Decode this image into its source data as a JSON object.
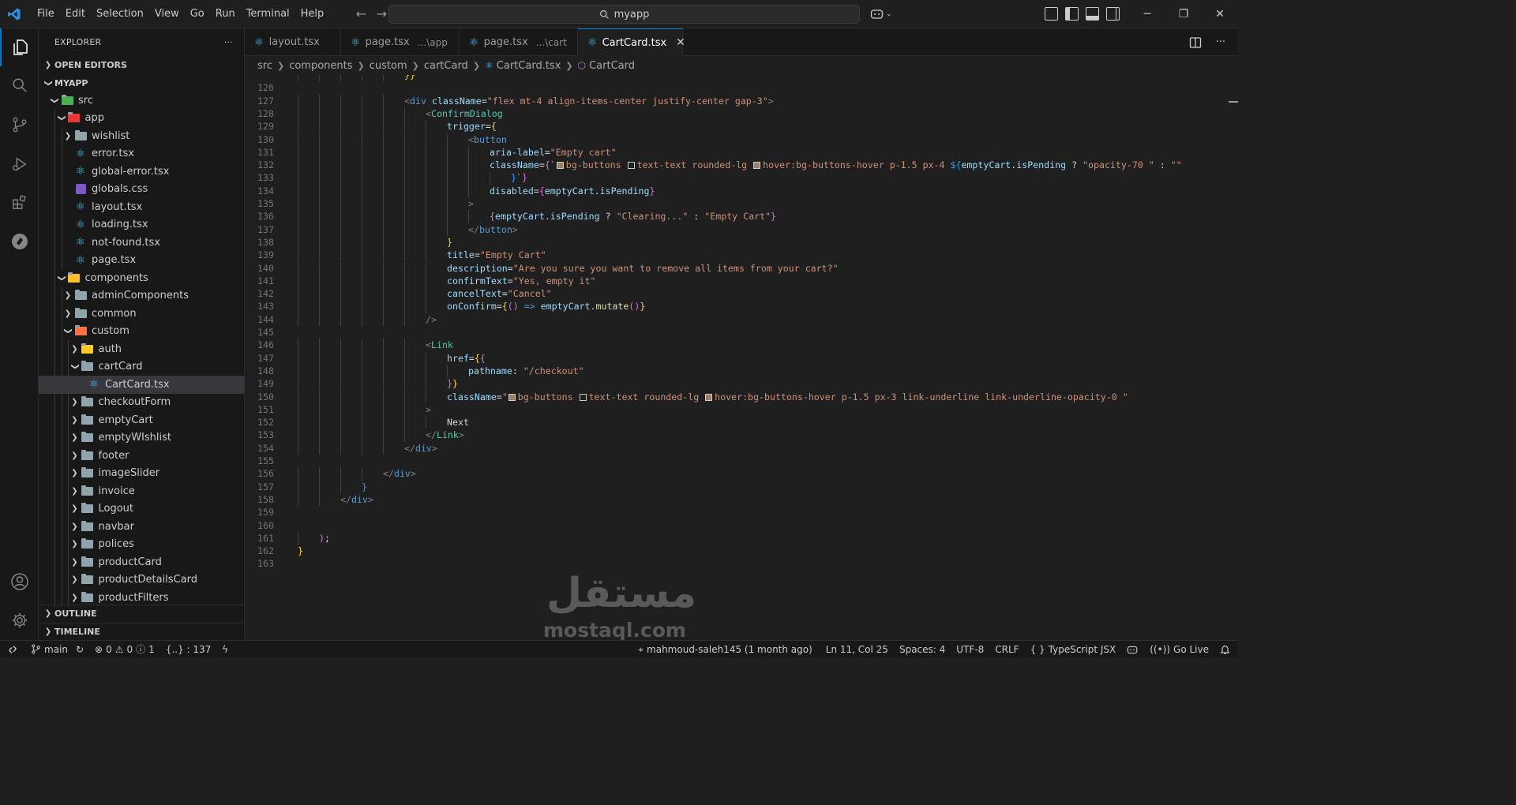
{
  "titlebar": {
    "menu": [
      "File",
      "Edit",
      "Selection",
      "View",
      "Go",
      "Run",
      "Terminal",
      "Help"
    ],
    "search_text": "myapp",
    "icons": [
      "vscode-logo",
      "back-arrow",
      "forward-arrow",
      "copilot-icon",
      "layout-icons",
      "minimize",
      "restore",
      "close"
    ]
  },
  "activitybar": [
    "explorer-icon",
    "search-icon",
    "source-control-icon",
    "run-debug-icon",
    "extensions-icon",
    "remote-explorer-icon",
    "account-icon",
    "settings-gear-icon"
  ],
  "sidebar": {
    "title": "EXPLORER",
    "more": "···",
    "open_editors": "OPEN EDITORS",
    "root": "MYAPP",
    "tree": [
      {
        "label": "src",
        "type": "folder-open",
        "depth": 1
      },
      {
        "label": "app",
        "type": "folder-open",
        "depth": 2
      },
      {
        "label": "wishlist",
        "type": "folder",
        "depth": 3
      },
      {
        "label": "error.tsx",
        "type": "react",
        "depth": 3
      },
      {
        "label": "global-error.tsx",
        "type": "react",
        "depth": 3
      },
      {
        "label": "globals.css",
        "type": "css",
        "depth": 3
      },
      {
        "label": "layout.tsx",
        "type": "react",
        "depth": 3
      },
      {
        "label": "loading.tsx",
        "type": "react",
        "depth": 3
      },
      {
        "label": "not-found.tsx",
        "type": "react",
        "depth": 3
      },
      {
        "label": "page.tsx",
        "type": "react",
        "depth": 3
      },
      {
        "label": "components",
        "type": "folder-open",
        "depth": 2
      },
      {
        "label": "adminComponents",
        "type": "folder",
        "depth": 3
      },
      {
        "label": "common",
        "type": "folder",
        "depth": 3
      },
      {
        "label": "custom",
        "type": "folder-open",
        "depth": 3
      },
      {
        "label": "auth",
        "type": "folder",
        "depth": 4
      },
      {
        "label": "cartCard",
        "type": "folder-open",
        "depth": 4
      },
      {
        "label": "CartCard.tsx",
        "type": "react",
        "depth": 5,
        "selected": true
      },
      {
        "label": "checkoutForm",
        "type": "folder",
        "depth": 4
      },
      {
        "label": "emptyCart",
        "type": "folder",
        "depth": 4
      },
      {
        "label": "emptyWIshlist",
        "type": "folder",
        "depth": 4
      },
      {
        "label": "footer",
        "type": "folder",
        "depth": 4
      },
      {
        "label": "imageSlider",
        "type": "folder",
        "depth": 4
      },
      {
        "label": "invoice",
        "type": "folder",
        "depth": 4
      },
      {
        "label": "Logout",
        "type": "folder",
        "depth": 4
      },
      {
        "label": "navbar",
        "type": "folder",
        "depth": 4
      },
      {
        "label": "polices",
        "type": "folder",
        "depth": 4
      },
      {
        "label": "productCard",
        "type": "folder",
        "depth": 4
      },
      {
        "label": "productDetailsCard",
        "type": "folder",
        "depth": 4
      },
      {
        "label": "productFilters",
        "type": "folder",
        "depth": 4
      }
    ],
    "outline": "OUTLINE",
    "timeline": "TIMELINE"
  },
  "tabs": [
    {
      "label": "layout.tsx",
      "desc": ""
    },
    {
      "label": "page.tsx",
      "desc": "...\\app"
    },
    {
      "label": "page.tsx",
      "desc": "...\\cart"
    },
    {
      "label": "CartCard.tsx",
      "desc": "",
      "active": true
    }
  ],
  "breadcrumb": [
    "src",
    "components",
    "custom",
    "cartCard",
    "CartCard.tsx",
    "CartCard"
  ],
  "editor": {
    "lines": [
      {
        "n": "",
        "indent": 5,
        "tokens": [
          [
            "t-br1",
            "}}"
          ]
        ]
      },
      {
        "n": "126",
        "indent": 0,
        "tokens": []
      },
      {
        "n": "127",
        "indent": 5,
        "tokens": [
          [
            "t-punc",
            "<"
          ],
          [
            "t-tag",
            "div"
          ],
          [
            "t-txt",
            " "
          ],
          [
            "t-attr",
            "className"
          ],
          [
            "t-txt",
            "="
          ],
          [
            "t-str",
            "\"flex mt-4 align-items-center justify-center gap-3\""
          ],
          [
            "t-punc",
            ">"
          ]
        ]
      },
      {
        "n": "128",
        "indent": 6,
        "tokens": [
          [
            "t-punc",
            "<"
          ],
          [
            "t-comp",
            "ConfirmDialog"
          ]
        ]
      },
      {
        "n": "129",
        "indent": 7,
        "tokens": [
          [
            "t-attr",
            "trigger"
          ],
          [
            "t-txt",
            "="
          ],
          [
            "t-br1",
            "{"
          ]
        ]
      },
      {
        "n": "130",
        "indent": 8,
        "tokens": [
          [
            "t-punc",
            "<"
          ],
          [
            "t-tag",
            "button"
          ]
        ]
      },
      {
        "n": "131",
        "indent": 9,
        "tokens": [
          [
            "t-attr",
            "aria-label"
          ],
          [
            "t-txt",
            "="
          ],
          [
            "t-str",
            "\"Empty cart\""
          ]
        ]
      },
      {
        "n": "132",
        "indent": 9,
        "tokens": [
          [
            "t-attr",
            "className"
          ],
          [
            "t-txt",
            "="
          ],
          [
            "t-br2",
            "{"
          ],
          [
            "t-str",
            "`"
          ],
          [
            "sw",
            "#9c8163"
          ],
          [
            "t-str",
            "bg-buttons "
          ],
          [
            "sw",
            "#1f1f1f"
          ],
          [
            "t-str",
            "text-text rounded-lg "
          ],
          [
            "sw",
            "#9c8163"
          ],
          [
            "t-str",
            "hover:bg-buttons-hover p-1.5 px-4 "
          ],
          [
            "t-br3",
            "${"
          ],
          [
            "t-var",
            "emptyCart"
          ],
          [
            "t-txt",
            "."
          ],
          [
            "t-var",
            "isPending"
          ],
          [
            "t-txt",
            " ? "
          ],
          [
            "t-str",
            "\"opacity-70 \""
          ],
          [
            "t-txt",
            " : "
          ],
          [
            "t-str",
            "\"\""
          ]
        ]
      },
      {
        "n": "133",
        "indent": 10,
        "tokens": [
          [
            "t-br3",
            "}"
          ],
          [
            "t-str",
            "`"
          ],
          [
            "t-br2",
            "}"
          ]
        ]
      },
      {
        "n": "134",
        "indent": 9,
        "tokens": [
          [
            "t-attr",
            "disabled"
          ],
          [
            "t-txt",
            "="
          ],
          [
            "t-br2",
            "{"
          ],
          [
            "t-var",
            "emptyCart"
          ],
          [
            "t-txt",
            "."
          ],
          [
            "t-var",
            "isPending"
          ],
          [
            "t-br2",
            "}"
          ]
        ]
      },
      {
        "n": "135",
        "indent": 8,
        "tokens": [
          [
            "t-punc",
            ">"
          ]
        ]
      },
      {
        "n": "136",
        "indent": 9,
        "tokens": [
          [
            "t-br2",
            "{"
          ],
          [
            "t-var",
            "emptyCart"
          ],
          [
            "t-txt",
            "."
          ],
          [
            "t-var",
            "isPending"
          ],
          [
            "t-txt",
            " ? "
          ],
          [
            "t-str",
            "\"Clearing...\""
          ],
          [
            "t-txt",
            " : "
          ],
          [
            "t-str",
            "\"Empty Cart\""
          ],
          [
            "t-br2",
            "}"
          ]
        ]
      },
      {
        "n": "137",
        "indent": 8,
        "tokens": [
          [
            "t-punc",
            "</"
          ],
          [
            "t-tag",
            "button"
          ],
          [
            "t-punc",
            ">"
          ]
        ]
      },
      {
        "n": "138",
        "indent": 7,
        "tokens": [
          [
            "t-br1",
            "}"
          ]
        ]
      },
      {
        "n": "139",
        "indent": 7,
        "tokens": [
          [
            "t-attr",
            "title"
          ],
          [
            "t-txt",
            "="
          ],
          [
            "t-str",
            "\"Empty Cart\""
          ]
        ]
      },
      {
        "n": "140",
        "indent": 7,
        "tokens": [
          [
            "t-attr",
            "description"
          ],
          [
            "t-txt",
            "="
          ],
          [
            "t-str",
            "\"Are you sure you want to remove all items from your cart?\""
          ]
        ]
      },
      {
        "n": "141",
        "indent": 7,
        "tokens": [
          [
            "t-attr",
            "confirmText"
          ],
          [
            "t-txt",
            "="
          ],
          [
            "t-str",
            "\"Yes, empty it\""
          ]
        ]
      },
      {
        "n": "142",
        "indent": 7,
        "tokens": [
          [
            "t-attr",
            "cancelText"
          ],
          [
            "t-txt",
            "="
          ],
          [
            "t-str",
            "\"Cancel\""
          ]
        ]
      },
      {
        "n": "143",
        "indent": 7,
        "tokens": [
          [
            "t-attr",
            "onConfirm"
          ],
          [
            "t-txt",
            "="
          ],
          [
            "t-br1",
            "{"
          ],
          [
            "t-br2",
            "()"
          ],
          [
            "t-kw",
            " => "
          ],
          [
            "t-var",
            "emptyCart"
          ],
          [
            "t-txt",
            "."
          ],
          [
            "t-fn",
            "mutate"
          ],
          [
            "t-br2",
            "()"
          ],
          [
            "t-br1",
            "}"
          ]
        ]
      },
      {
        "n": "144",
        "indent": 6,
        "tokens": [
          [
            "t-punc",
            "/>"
          ]
        ]
      },
      {
        "n": "145",
        "indent": 0,
        "tokens": []
      },
      {
        "n": "146",
        "indent": 6,
        "tokens": [
          [
            "t-punc",
            "<"
          ],
          [
            "t-comp",
            "Link"
          ]
        ]
      },
      {
        "n": "147",
        "indent": 7,
        "tokens": [
          [
            "t-attr",
            "href"
          ],
          [
            "t-txt",
            "="
          ],
          [
            "t-br1",
            "{"
          ],
          [
            "t-br2",
            "{"
          ]
        ]
      },
      {
        "n": "148",
        "indent": 8,
        "tokens": [
          [
            "t-attr",
            "pathname"
          ],
          [
            "t-txt",
            ": "
          ],
          [
            "t-str",
            "\"/checkout\""
          ]
        ]
      },
      {
        "n": "149",
        "indent": 7,
        "tokens": [
          [
            "t-br2",
            "}"
          ],
          [
            "t-br1",
            "}"
          ]
        ]
      },
      {
        "n": "150",
        "indent": 7,
        "tokens": [
          [
            "t-attr",
            "className"
          ],
          [
            "t-txt",
            "="
          ],
          [
            "t-str",
            "\""
          ],
          [
            "sw",
            "#9c8163"
          ],
          [
            "t-str",
            "bg-buttons "
          ],
          [
            "sw",
            "#1f1f1f"
          ],
          [
            "t-str",
            "text-text rounded-lg "
          ],
          [
            "sw",
            "#9c8163"
          ],
          [
            "t-str",
            "hover:bg-buttons-hover p-1.5 px-3 link-underline link-underline-opacity-0 \""
          ]
        ]
      },
      {
        "n": "151",
        "indent": 6,
        "tokens": [
          [
            "t-punc",
            ">"
          ]
        ]
      },
      {
        "n": "152",
        "indent": 7,
        "tokens": [
          [
            "t-txt",
            "Next"
          ]
        ]
      },
      {
        "n": "153",
        "indent": 6,
        "tokens": [
          [
            "t-punc",
            "</"
          ],
          [
            "t-comp",
            "Link"
          ],
          [
            "t-punc",
            ">"
          ]
        ]
      },
      {
        "n": "154",
        "indent": 5,
        "tokens": [
          [
            "t-punc",
            "</"
          ],
          [
            "t-tag",
            "div"
          ],
          [
            "t-punc",
            ">"
          ]
        ]
      },
      {
        "n": "155",
        "indent": 0,
        "tokens": []
      },
      {
        "n": "156",
        "indent": 4,
        "tokens": [
          [
            "t-punc",
            "</"
          ],
          [
            "t-tag",
            "div"
          ],
          [
            "t-punc",
            ">"
          ]
        ]
      },
      {
        "n": "157",
        "indent": 3,
        "tokens": [
          [
            "t-br3",
            "}"
          ]
        ]
      },
      {
        "n": "158",
        "indent": 2,
        "tokens": [
          [
            "t-punc",
            "</"
          ],
          [
            "t-tag",
            "div"
          ],
          [
            "t-punc",
            ">"
          ]
        ]
      },
      {
        "n": "159",
        "indent": 0,
        "tokens": []
      },
      {
        "n": "160",
        "indent": 0,
        "tokens": []
      },
      {
        "n": "161",
        "indent": 1,
        "tokens": [
          [
            "t-br2",
            ")"
          ],
          [
            "t-txt",
            ";"
          ]
        ]
      },
      {
        "n": "162",
        "indent": 0,
        "tokens": [
          [
            "t-br1",
            "}"
          ]
        ]
      },
      {
        "n": "163",
        "indent": 0,
        "tokens": []
      }
    ]
  },
  "watermark": {
    "arabic": "مستقل",
    "latin": "mostaql.com"
  },
  "statusbar": {
    "branch": "main",
    "errors": "0",
    "warnings": "0",
    "infos": "1",
    "selection": "{..} : 137",
    "blame": "mahmoud-saleh145 (1 month ago)",
    "cursor": "Ln 11, Col 25",
    "spaces": "Spaces: 4",
    "encoding": "UTF-8",
    "eol": "CRLF",
    "language": "TypeScript JSX",
    "golive": "Go Live"
  }
}
